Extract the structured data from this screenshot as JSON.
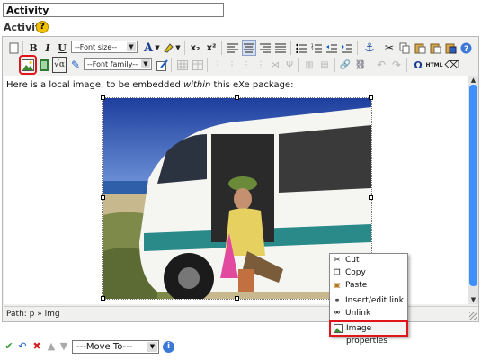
{
  "title_field": {
    "value": "Activity"
  },
  "section": {
    "label": "Activity",
    "help_icon": "?"
  },
  "toolbar": {
    "font_size_label": "--Font size--",
    "font_family_label": "--Font family--",
    "bold": "B",
    "italic": "I",
    "underline": "U",
    "subscript": "x₂",
    "superscript": "x²",
    "omega": "Ω",
    "html": "HTML"
  },
  "editor": {
    "content_text_before": "Here is a local image, to be embedded ",
    "content_text_em": "within",
    "content_text_after": " this eXe package:",
    "path_label": "Path: p » img"
  },
  "context_menu": {
    "items": [
      {
        "label": "Cut",
        "icon": "scissors-icon"
      },
      {
        "label": "Copy",
        "icon": "copy-icon"
      },
      {
        "label": "Paste",
        "icon": "paste-icon"
      },
      {
        "label": "Insert/edit link",
        "icon": "link-icon"
      },
      {
        "label": "Unlink",
        "icon": "unlink-icon"
      },
      {
        "label": "Image properties",
        "icon": "image-icon"
      }
    ]
  },
  "bottom_bar": {
    "move_to": "---Move To---"
  },
  "colors": {
    "highlight": "#e0161b",
    "scroll": "#3f8fff",
    "help": "#f3c300"
  }
}
